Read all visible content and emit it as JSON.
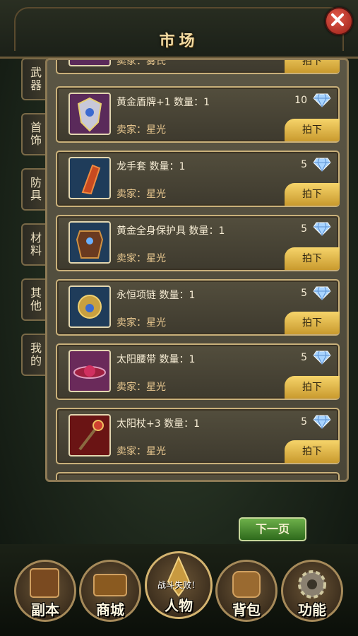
{
  "header": {
    "title": "市场",
    "close_icon": "close-icon"
  },
  "side_tabs": [
    {
      "label": "武器"
    },
    {
      "label": "首饰"
    },
    {
      "label": "防具"
    },
    {
      "label": "材料"
    },
    {
      "label": "其他"
    },
    {
      "label": "我的"
    }
  ],
  "listings": {
    "partial_top": {
      "seller_label": "卖家：",
      "seller": "雾氏",
      "action": "拍下"
    },
    "items": [
      {
        "name": "黄金盾牌+1 数量：1",
        "seller": "卖家：星光",
        "price": "10",
        "action": "拍下",
        "icon": "golden-shield-icon",
        "color": "#5a2a5a"
      },
      {
        "name": "龙手套 数量：1",
        "seller": "卖家：星光",
        "price": "5",
        "action": "拍下",
        "icon": "dragon-gauntlet-icon",
        "color": "#1f3c5a"
      },
      {
        "name": "黄金全身保护具 数量：1",
        "seller": "卖家：星光",
        "price": "5",
        "action": "拍下",
        "icon": "golden-armor-icon",
        "color": "#1f3c5a"
      },
      {
        "name": "永恒项链 数量：1",
        "seller": "卖家：星光",
        "price": "5",
        "action": "拍下",
        "icon": "eternal-necklace-icon",
        "color": "#1f3c5a"
      },
      {
        "name": "太阳腰带 数量：1",
        "seller": "卖家：星光",
        "price": "5",
        "action": "拍下",
        "icon": "sun-belt-icon",
        "color": "#6a2a5a"
      },
      {
        "name": "太阳杖+3 数量：1",
        "seller": "卖家：星光",
        "price": "5",
        "action": "拍下",
        "icon": "sun-staff-icon",
        "color": "#6a1414"
      }
    ]
  },
  "next_page": "下一页",
  "bottom_nav": [
    {
      "label": "副本",
      "icon": "book-icon"
    },
    {
      "label": "商城",
      "icon": "treasure-chest-icon"
    },
    {
      "label": "人物",
      "icon": "helmet-icon",
      "sub": "战斗失败！"
    },
    {
      "label": "背包",
      "icon": "backpack-icon"
    },
    {
      "label": "功能",
      "icon": "gear-icon"
    }
  ]
}
